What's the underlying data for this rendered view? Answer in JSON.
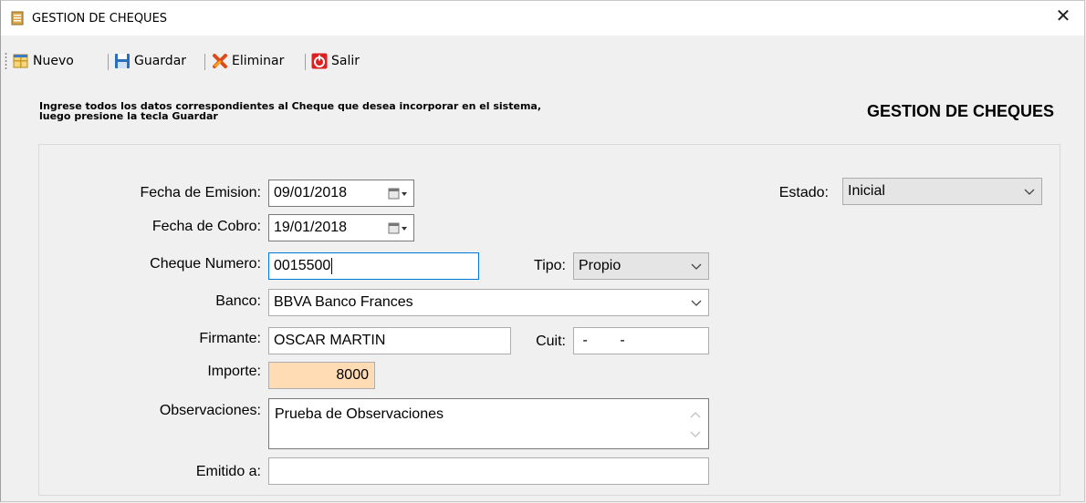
{
  "window": {
    "title": "GESTION DE CHEQUES",
    "close_glyph": "✕"
  },
  "toolbar": {
    "items": [
      {
        "label": "Nuevo",
        "icon": "new-icon"
      },
      {
        "label": "Guardar",
        "icon": "save-icon"
      },
      {
        "label": "Eliminar",
        "icon": "delete-icon"
      },
      {
        "label": "Salir",
        "icon": "exit-icon"
      }
    ]
  },
  "instructions": "Ingrese todos los datos correspondientes al Cheque que desea incorporar en el sistema, luego presione la tecla Guardar",
  "heading": "GESTION DE CHEQUES",
  "form": {
    "fecha_emision": {
      "label": "Fecha de Emision:",
      "value": "09/01/2018"
    },
    "fecha_cobro": {
      "label": "Fecha de Cobro:",
      "value": "19/01/2018"
    },
    "cheque_numero": {
      "label": "Cheque Numero:",
      "value": "0015500"
    },
    "tipo": {
      "label": "Tipo:",
      "value": "Propio"
    },
    "banco": {
      "label": "Banco:",
      "value": "BBVA Banco Frances"
    },
    "firmante": {
      "label": "Firmante:",
      "value": "OSCAR MARTIN"
    },
    "cuit": {
      "label": "Cuit:",
      "value": " -        -"
    },
    "importe": {
      "label": "Importe:",
      "value": "8000"
    },
    "observaciones": {
      "label": "Observaciones:",
      "value": "Prueba de Observaciones"
    },
    "emitido_a": {
      "label": "Emitido a:",
      "value": ""
    },
    "estado": {
      "label": "Estado:",
      "value": "Inicial"
    }
  },
  "colors": {
    "importe_bg": "#ffdcb4",
    "focus_border": "#0078d7",
    "delete_icon": "#e04a1a",
    "exit_icon": "#e02020",
    "save_icon": "#2a6fb8"
  }
}
